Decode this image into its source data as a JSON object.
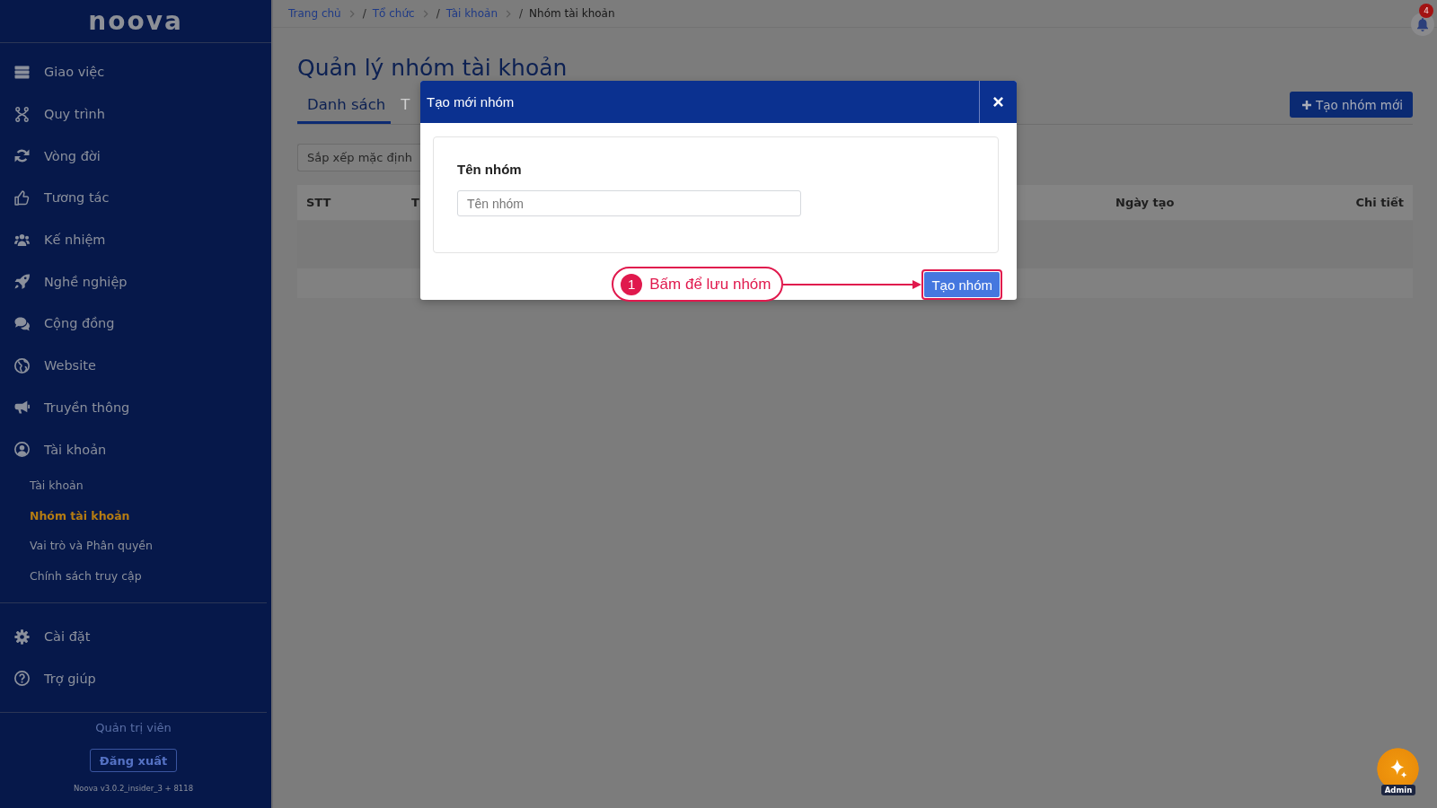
{
  "sidebar": {
    "logo": "noova",
    "menu": [
      {
        "label": "Giao việc",
        "selected": false
      },
      {
        "label": "Quy trình",
        "selected": false
      },
      {
        "label": "Vòng đời",
        "selected": false
      },
      {
        "label": "Tương tác",
        "selected": false
      },
      {
        "label": "Kế nhiệm",
        "selected": false
      },
      {
        "label": "Nghề nghiệp",
        "selected": false
      },
      {
        "label": "Cộng đồng",
        "selected": false
      },
      {
        "label": "Website",
        "selected": false
      },
      {
        "label": "Truyền thông",
        "selected": false
      },
      {
        "label": "Tài khoản",
        "selected": false,
        "children": [
          {
            "label": "Tài khoản",
            "selected": false
          },
          {
            "label": "Nhóm tài khoản",
            "selected": true
          },
          {
            "label": "Vai trò và Phân quyền",
            "selected": false
          },
          {
            "label": "Chính sách truy cập",
            "selected": false
          }
        ]
      }
    ],
    "bottom_menu": [
      {
        "label": "Cài đặt",
        "selected": false
      },
      {
        "label": "Trợ giúp",
        "selected": false
      }
    ],
    "role": "Quản trị viên",
    "logout_button": "Đăng xuất",
    "version": "Noova v3.0.2_insider_3 + 8118"
  },
  "breadcrumb": {
    "separator": "/",
    "items": [
      {
        "label": "Trang chủ",
        "current": false
      },
      {
        "label": "Tổ chức",
        "current": false
      },
      {
        "label": "Tài khoản",
        "current": false
      },
      {
        "label": "Nhóm tài khoản",
        "current": true
      }
    ]
  },
  "notifications": {
    "count": "4"
  },
  "page": {
    "title": "Quản lý nhóm tài khoản",
    "tabs": [
      {
        "label": "Danh sách",
        "selected": true
      },
      {
        "label": "T",
        "selected": false
      }
    ],
    "create_button": "Tạo nhóm mới",
    "sort_select": {
      "value": "Sắp xếp mặc định"
    },
    "table": {
      "columns": [
        "STT",
        "T",
        "Ngày tạo",
        "Chi tiết"
      ]
    }
  },
  "dialog": {
    "title": "Tạo mới nhóm",
    "fields": [
      {
        "label": "Tên nhóm",
        "placeholder": "Tên nhóm"
      }
    ],
    "submit_button": "Tạo nhóm",
    "callout": {
      "number": "1",
      "text": "Bấm để lưu nhóm"
    }
  },
  "assistant": {
    "badge": "Admin"
  }
}
